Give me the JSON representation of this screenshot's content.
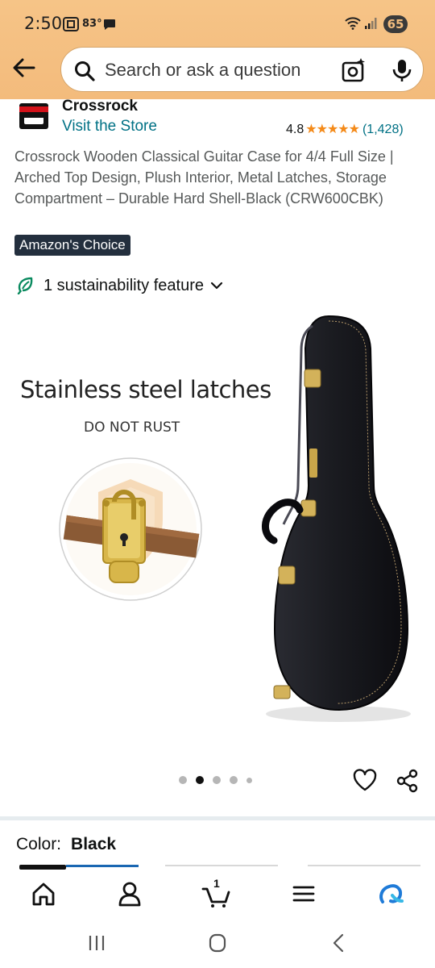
{
  "status_bar": {
    "time": "2:50",
    "temperature": "83°",
    "battery": "65"
  },
  "search": {
    "placeholder": "Search or ask a question"
  },
  "brand": {
    "name": "Crossrock",
    "visit_store": "Visit the Store"
  },
  "rating": {
    "score": "4.8",
    "stars": "★★★★★",
    "count": "(1,428)"
  },
  "product": {
    "title": "Crossrock Wooden Classical Guitar Case for 4/4 Full Size | Arched Top Design, Plush Interior, Metal Latches, Storage Compartment – Durable Hard Shell-Black (CRW600CBK)",
    "badge": "Amazon's Choice",
    "sustainability": "1 sustainability feature"
  },
  "image": {
    "headline": "Stainless steel latches",
    "subline": "DO NOT RUST",
    "carousel_active_index": 1,
    "carousel_count": 5
  },
  "color": {
    "label": "Color:",
    "value": "Black"
  },
  "cart": {
    "count": "1"
  },
  "theme": {
    "header_bg": "#f3bb7c",
    "link": "#007185",
    "star": "#f48a19",
    "badge_bg": "#232f3e"
  }
}
